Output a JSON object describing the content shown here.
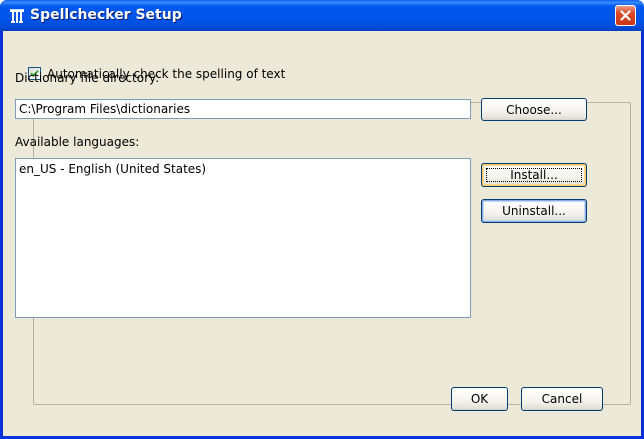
{
  "window": {
    "title": "Spellchecker Setup",
    "icon": "spellcheck-app-icon",
    "close_icon": "close-icon",
    "titlebar_color": "#0055e5",
    "close_color": "#e04a2a"
  },
  "auto_check": {
    "checked": true,
    "label": "Automatically check the spelling of text"
  },
  "directory": {
    "label": "Dictionary file directory:",
    "value": "C:\\Program Files\\dictionaries",
    "choose_label": "Choose..."
  },
  "languages": {
    "label": "Available languages:",
    "items": [
      "en_US - English (United States)"
    ],
    "install_label": "Install...",
    "uninstall_label": "Uninstall..."
  },
  "footer": {
    "ok_label": "OK",
    "cancel_label": "Cancel"
  }
}
